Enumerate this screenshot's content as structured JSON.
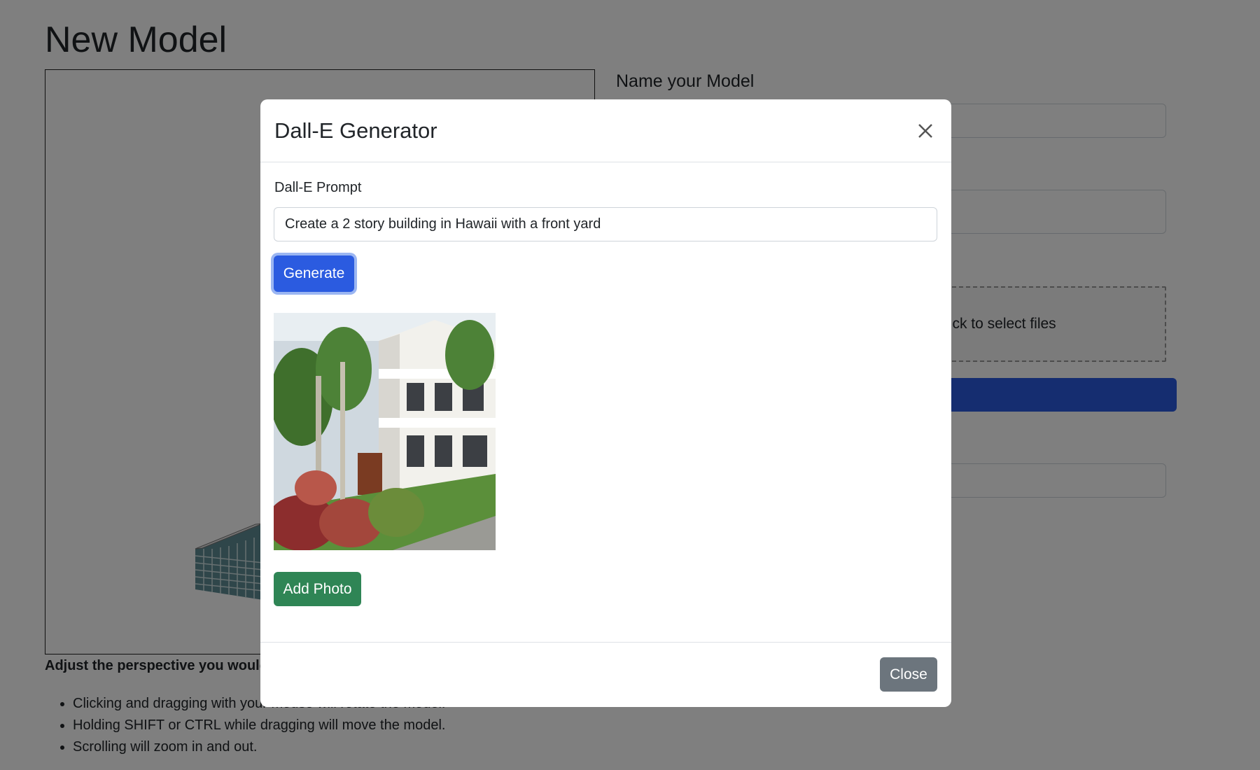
{
  "page": {
    "title": "New Model",
    "name_label": "Name your Model",
    "dropzone_text": "Drag 'n' drop some files here, or click to select files",
    "perspective_text": "Adjust the perspective you would like for the thumbnail:",
    "tips": [
      "Clicking and dragging with your mouse will rotate the model.",
      "Holding SHIFT or CTRL while dragging will move the model.",
      "Scrolling will zoom in and out."
    ]
  },
  "modal": {
    "title": "Dall-E Generator",
    "prompt_label": "Dall-E Prompt",
    "prompt_value": "Create a 2 story building in Hawaii with a front yard",
    "generate_label": "Generate",
    "add_photo_label": "Add Photo",
    "close_label": "Close"
  },
  "colors": {
    "primary": "#2b5be0",
    "success": "#2f8555",
    "secondary": "#6c757d",
    "backdrop": "rgba(0,0,0,0.5)"
  },
  "icons": {
    "close": "close-icon"
  }
}
